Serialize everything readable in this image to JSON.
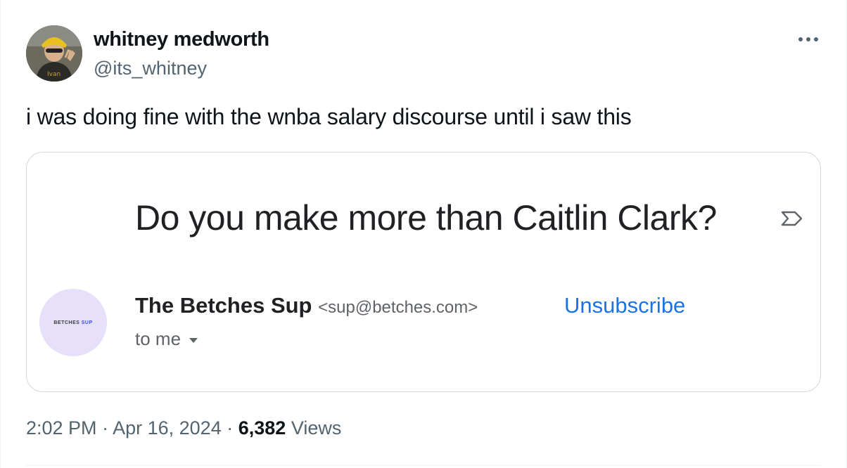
{
  "author": {
    "display_name": "whitney medworth",
    "handle": "@its_whitney"
  },
  "tweet_text": "i was doing fine with the wnba salary discourse until i saw this",
  "email": {
    "subject": "Do you make more than Caitlin Clark?",
    "sender_name": "The Betches Sup",
    "sender_email": "<sup@betches.com>",
    "unsubscribe_label": "Unsubscribe",
    "recipient_label": "to me",
    "sender_avatar_text": "BETCHES",
    "sender_avatar_accent": "SUP",
    "link_color": "#1a73e8"
  },
  "meta": {
    "time": "2:02 PM",
    "date": "Apr 16, 2024",
    "separator": "·",
    "views_count": "6,382",
    "views_label": "Views"
  },
  "icons": {
    "more": "more-horizontal-icon",
    "importance": "importance-marker-icon",
    "caret": "chevron-down-icon"
  }
}
